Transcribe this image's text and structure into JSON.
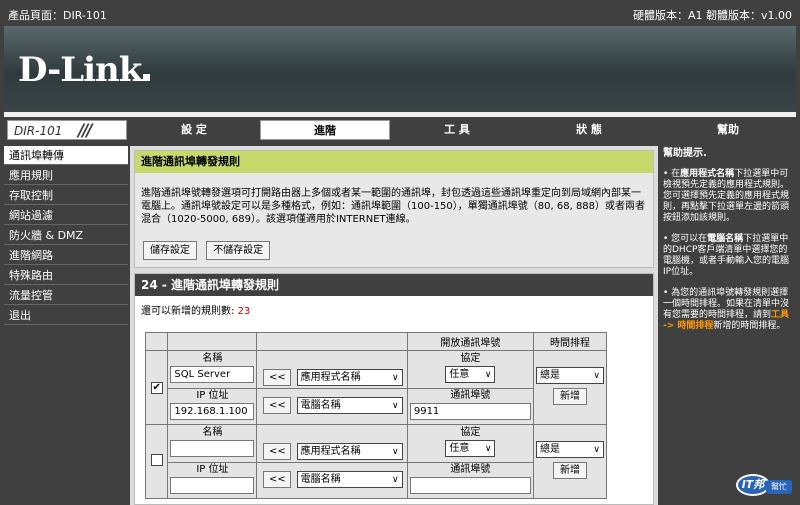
{
  "topbar": {
    "product_page": "產品頁面：DIR-101",
    "version": "硬體版本：A1  韌體版本：v1.00"
  },
  "logo": "D-Link",
  "model": "DIR-101",
  "tabs": [
    {
      "label": "設 定",
      "active": false
    },
    {
      "label": "進階",
      "active": true
    },
    {
      "label": "工 具",
      "active": false
    },
    {
      "label": "狀 態",
      "active": false
    },
    {
      "label": "幫助",
      "active": false
    }
  ],
  "sidebar": [
    "通訊埠轉傳",
    "應用規則",
    "存取控制",
    "網站過濾",
    "防火牆 & DMZ",
    "進階網路",
    "特殊路由",
    "流量控管",
    "退出"
  ],
  "main": {
    "section_title": "進階通訊埠轉發規則",
    "description": "進階通訊埠號轉發選項可打開路由器上多個或者某一範圍的通訊埠，封包透過這些通訊埠重定向到局域網內部某一電腦上。通訊埠號設定可以是多種格式，例如：通訊埠範圍（100-150），單獨通訊埠號（80, 68, 888）或者兩者混合（1020-5000, 689）。該選項僅適用於INTERNET連線。",
    "save_button": "儲存設定",
    "nosave_button": "不儲存設定",
    "rules_title": "24 - 進階通訊埠轉發規則",
    "remaining_label": "還可以新增的規則數:",
    "remaining_count": "23",
    "col_open_ports": "開放通訊埠號",
    "col_schedule": "時間排程",
    "rules": [
      {
        "checked": true,
        "name_label": "名稱",
        "name_value": "SQL Server",
        "ip_label": "IP 位址",
        "ip_value": "192.168.1.100",
        "arrow": "<<",
        "app_select": "應用程式名稱",
        "pc_select": "電腦名稱",
        "protocol_label": "協定",
        "protocol_value": "任意",
        "port_label": "通訊埠號",
        "port_value": "9911",
        "schedule_value": "總是",
        "add_button": "新增"
      },
      {
        "checked": false,
        "name_label": "名稱",
        "name_value": "",
        "ip_label": "IP 位址",
        "ip_value": "",
        "arrow": "<<",
        "app_select": "應用程式名稱",
        "pc_select": "電腦名稱",
        "protocol_label": "協定",
        "protocol_value": "任意",
        "port_label": "通訊埠號",
        "port_value": "",
        "schedule_value": "總是",
        "add_button": "新增"
      }
    ]
  },
  "help": {
    "title": "幫助提示.",
    "p1_pre": "• 在",
    "p1_bold": "應用程式名稱",
    "p1_post": "下拉選單中可檢視預先定義的應用程式規則。您可選擇預先定義的應用程式規則，再點擊下拉選單左邊的箭頭按鈕添加該規則。",
    "p2_pre": "• 您可以在",
    "p2_bold": "電腦名稱",
    "p2_post": "下拉選單中的DHCP客戶端清單中選擇您的電腦機，或者手動輸入您的電腦IP位址。",
    "p3_pre": "• 為您的通訊埠號轉發規則選擇一個時間排程。如果在清單中沒有您需要的時間排程，請到",
    "p3_hl": "工具 -> 時間排程",
    "p3_post": "新增的時間排程。"
  },
  "watermark": {
    "badge": "IT邦",
    "text": "幫忙"
  }
}
